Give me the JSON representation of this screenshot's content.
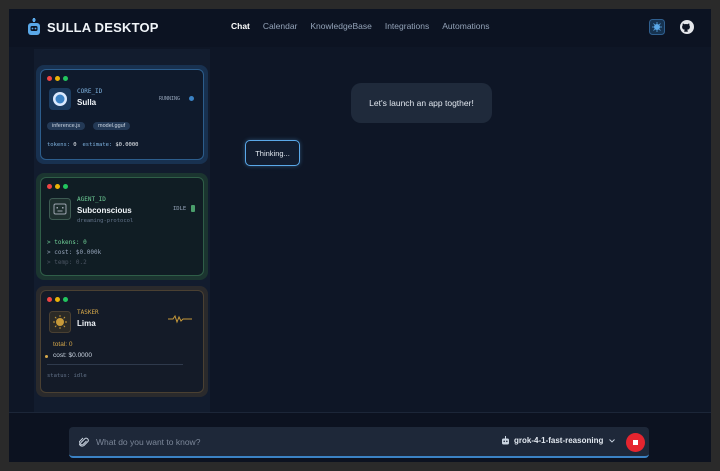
{
  "app": {
    "title": "SULLA DESKTOP",
    "accent": "#5aa8e8"
  },
  "nav": {
    "items": [
      "Chat",
      "Calendar",
      "KnowledgeBase",
      "Integrations",
      "Automations"
    ],
    "active": "Chat"
  },
  "header_icons": [
    "sulla-icon",
    "github-icon"
  ],
  "agents": {
    "core": {
      "id_label": "CORE_ID",
      "name": "Sulla",
      "status": "RUNNING",
      "tags": [
        "inference.js",
        "model.gguf"
      ],
      "tokens_label": "tokens:",
      "tokens_value": "0",
      "estimate_label": "estimate:",
      "estimate_value": "$0.0000",
      "color": "#3b82c4"
    },
    "subconscious": {
      "id_label": "AGENT_ID",
      "name": "Subconscious",
      "status": "IDLE",
      "subtitle": "dreaming-protocol",
      "lines": [
        "> tokens: 0",
        "> cost: $0.000k",
        "> temp: 0.2"
      ],
      "color": "#4a9e6b"
    },
    "tasker": {
      "id_label": "TASKER",
      "name": "Lima",
      "total_label": "total: 0",
      "cost_label": "cost: $0.0000",
      "status_line": "status: idle",
      "color": "#c79a3a"
    }
  },
  "chat": {
    "messages": [
      {
        "role": "user",
        "text": "Let's launch an app togther!"
      },
      {
        "role": "assistant",
        "text": "Thinking..."
      }
    ]
  },
  "composer": {
    "placeholder": "What do you want to know?",
    "model": "grok-4-1-fast-reasoning",
    "stop_color": "#e5252f"
  }
}
